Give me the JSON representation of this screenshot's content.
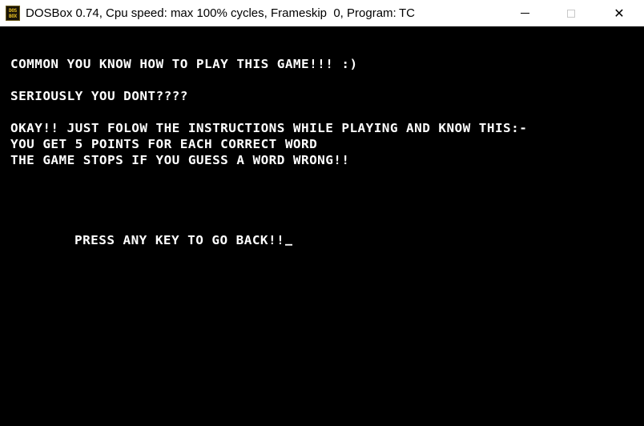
{
  "window": {
    "title": "DOSBox 0.74, Cpu speed: max 100% cycles, Frameskip  0, Program:",
    "program": "TC",
    "icon_top": "DOS",
    "icon_bottom": "BOX",
    "icon": "dosbox-app-icon",
    "controls": {
      "minimize": "minimize-icon",
      "maximize": "maximize-icon",
      "close": "close-icon",
      "close_glyph": "✕"
    }
  },
  "screen": {
    "background": "#000000",
    "text_color": "#ffffff",
    "lines": [
      "COMMON YOU KNOW HOW TO PLAY THIS GAME!!! :)",
      "SERIOUSLY YOU DONT????",
      "OKAY!! JUST FOLOW THE INSTRUCTIONS WHILE PLAYING AND KNOW THIS:-",
      "YOU GET 5 POINTS FOR EACH CORRECT WORD",
      "THE GAME STOPS IF YOU GUESS A WORD WRONG!!"
    ],
    "prompt": "PRESS ANY KEY TO GO BACK!!"
  }
}
